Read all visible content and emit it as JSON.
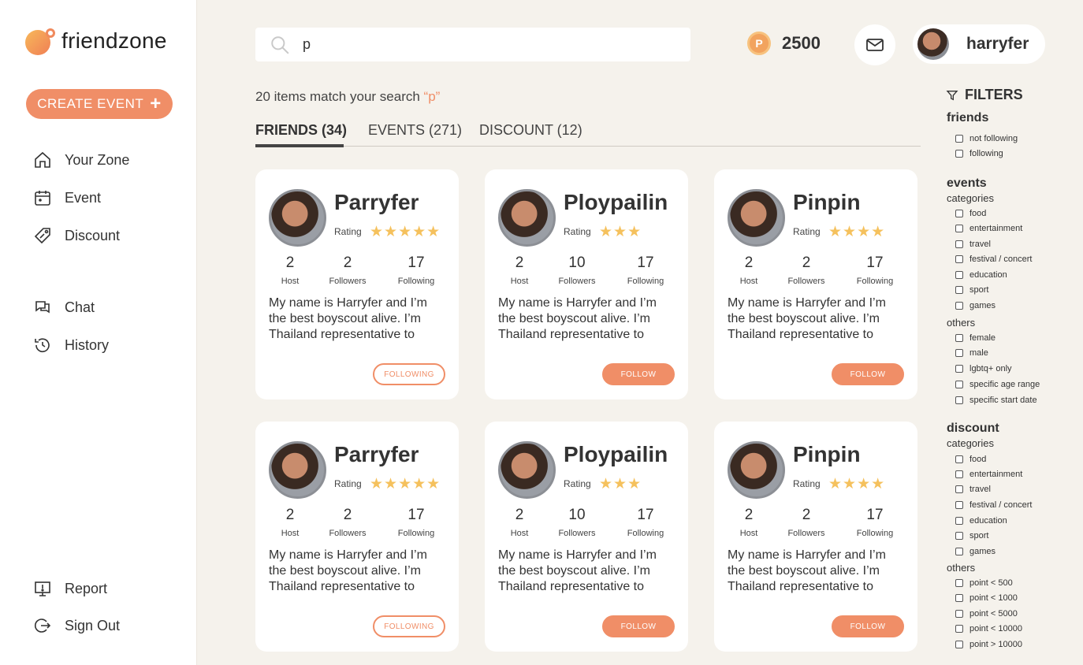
{
  "app": {
    "name": "friendzone"
  },
  "sidebar": {
    "create_label": "CREATE EVENT",
    "nav": [
      {
        "label": "Your Zone",
        "icon": "home-icon"
      },
      {
        "label": "Event",
        "icon": "calendar-icon"
      },
      {
        "label": "Discount",
        "icon": "tag-icon"
      },
      {
        "label": "Chat",
        "icon": "chat-icon"
      },
      {
        "label": "History",
        "icon": "history-icon"
      },
      {
        "label": "Report",
        "icon": "report-icon"
      },
      {
        "label": "Sign Out",
        "icon": "sign-out-icon"
      }
    ]
  },
  "search": {
    "value": "p",
    "placeholder": ""
  },
  "header": {
    "points": "2500",
    "username": "harryfer"
  },
  "results": {
    "prefix": "20 items match your search",
    "query": "“p”"
  },
  "tabs": [
    "FRIENDS (34)",
    "EVENTS (271)",
    "DISCOUNT (12)"
  ],
  "cards": [
    {
      "name": "Parryfer",
      "rating_label": "Rating",
      "stars": "★★★★★",
      "host": "2",
      "followers": "2",
      "following": "17",
      "bio": "My name is Harryfer and I’m the best boyscout alive. I’m Thailand representative to",
      "button": "FOLLOWING"
    },
    {
      "name": "Ploypailin",
      "rating_label": "Rating",
      "stars": "★★★",
      "host": "2",
      "followers": "10",
      "following": "17",
      "bio": "My name is Harryfer and I’m the best boyscout alive. I’m Thailand representative to",
      "button": "FOLLOW"
    },
    {
      "name": "Pinpin",
      "rating_label": "Rating",
      "stars": "★★★★",
      "host": "2",
      "followers": "2",
      "following": "17",
      "bio": "My name is Harryfer and I’m the best boyscout alive. I’m Thailand representative to",
      "button": "FOLLOW"
    },
    {
      "name": "Parryfer",
      "rating_label": "Rating",
      "stars": "★★★★★",
      "host": "2",
      "followers": "2",
      "following": "17",
      "bio": "My name is Harryfer and I’m the best boyscout alive. I’m Thailand representative to",
      "button": "FOLLOWING"
    },
    {
      "name": "Ploypailin",
      "rating_label": "Rating",
      "stars": "★★★",
      "host": "2",
      "followers": "10",
      "following": "17",
      "bio": "My name is Harryfer and I’m the best boyscout alive. I’m Thailand representative to",
      "button": "FOLLOW"
    },
    {
      "name": "Pinpin",
      "rating_label": "Rating",
      "stars": "★★★★",
      "host": "2",
      "followers": "2",
      "following": "17",
      "bio": "My name is Harryfer and I’m the best boyscout alive. I’m Thailand representative to",
      "button": "FOLLOW"
    }
  ],
  "stat_labels": {
    "host": "Host",
    "followers": "Followers",
    "following": "Following"
  },
  "filters": {
    "title": "FILTERS",
    "friends": {
      "heading": "friends",
      "options": [
        "not following",
        "following"
      ]
    },
    "events": {
      "heading": "events",
      "categories_label": "categories",
      "categories": [
        "food",
        "entertainment",
        "travel",
        "festival / concert",
        "education",
        "sport",
        "games"
      ],
      "others_label": "others",
      "others": [
        "female",
        "male",
        "lgbtq+ only",
        "specific age range",
        "specific start date"
      ]
    },
    "discount": {
      "heading": "discount",
      "categories_label": "categories",
      "categories": [
        "food",
        "entertainment",
        "travel",
        "festival / concert",
        "education",
        "sport",
        "games"
      ],
      "others_label": "others",
      "others": [
        "point < 500",
        "point < 1000",
        "point < 5000",
        "point < 10000",
        "point > 10000"
      ]
    }
  },
  "colors": {
    "accent": "#f08e67",
    "star": "#f5c15d",
    "background": "#f5f2ec"
  }
}
